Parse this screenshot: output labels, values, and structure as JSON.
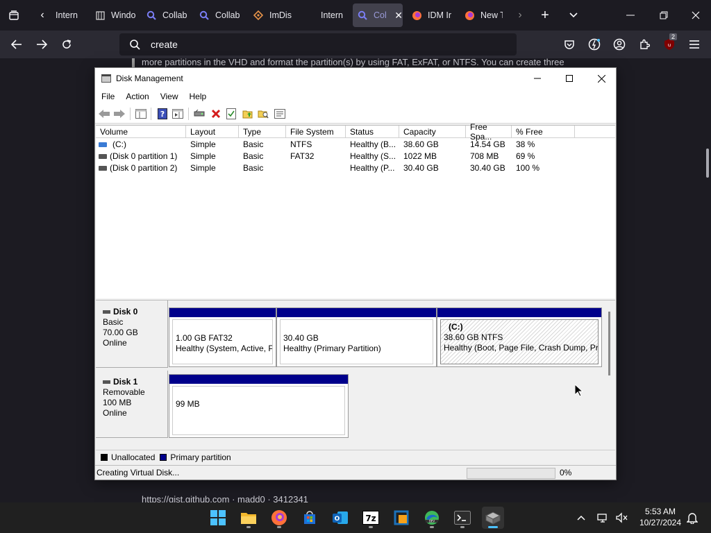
{
  "browser": {
    "tabs": [
      {
        "label": "Intern",
        "icon": "page-icon"
      },
      {
        "label": "Windo",
        "icon": "page-icon"
      },
      {
        "label": "Collab",
        "icon": "search-icon"
      },
      {
        "label": "Collab",
        "icon": "search-icon"
      },
      {
        "label": "ImDis",
        "icon": "code-icon"
      },
      {
        "label": "Intern",
        "icon": "page-icon"
      },
      {
        "label": "Col",
        "icon": "search-icon",
        "active": true
      },
      {
        "label": "IDM Ir",
        "icon": "firefox-icon"
      },
      {
        "label": "New T",
        "icon": "firefox-icon"
      }
    ],
    "url_text": "create",
    "extension_badge": "2"
  },
  "webpage": {
    "text_top": "more partitions in the VHD and format the partition(s) by using FAT, ExFAT, or NTFS. You can create three",
    "text_bottom": "https://gist.github.com · madd0 · 3412341"
  },
  "disk_management": {
    "title": "Disk Management",
    "menu": [
      "File",
      "Action",
      "View",
      "Help"
    ],
    "columns": [
      "Volume",
      "Layout",
      "Type",
      "File System",
      "Status",
      "Capacity",
      "Free Spa...",
      "% Free"
    ],
    "volumes": [
      {
        "volume": "(C:)",
        "layout": "Simple",
        "type": "Basic",
        "fs": "NTFS",
        "status": "Healthy (B...",
        "capacity": "38.60 GB",
        "free": "14.54 GB",
        "pct_free": "38 %"
      },
      {
        "volume": "(Disk 0 partition 1)",
        "layout": "Simple",
        "type": "Basic",
        "fs": "FAT32",
        "status": "Healthy (S...",
        "capacity": "1022 MB",
        "free": "708 MB",
        "pct_free": "69 %"
      },
      {
        "volume": "(Disk 0 partition 2)",
        "layout": "Simple",
        "type": "Basic",
        "fs": "",
        "status": "Healthy (P...",
        "capacity": "30.40 GB",
        "free": "30.40 GB",
        "pct_free": "100 %"
      }
    ],
    "disks": [
      {
        "name": "Disk 0",
        "kind": "Basic",
        "size": "70.00 GB",
        "state": "Online",
        "partitions": [
          {
            "title": "",
            "line1": "1.00 GB FAT32",
            "line2": "Healthy (System, Active, P"
          },
          {
            "title": "",
            "line1": "30.40 GB",
            "line2": "Healthy (Primary Partition)"
          },
          {
            "title": "(C:)",
            "line1": "38.60 GB NTFS",
            "line2": "Healthy (Boot, Page File, Crash Dump, Prir"
          }
        ]
      },
      {
        "name": "Disk 1",
        "kind": "Removable",
        "size": "100 MB",
        "state": "Online",
        "partitions": [
          {
            "title": "",
            "line1": "99 MB",
            "line2": ""
          }
        ]
      }
    ],
    "legend": [
      {
        "label": "Unallocated",
        "color": "#000000"
      },
      {
        "label": "Primary partition",
        "color": "#00008b"
      }
    ],
    "status_text": "Creating Virtual Disk...",
    "progress_percent": 0,
    "progress_label": "0%"
  },
  "taskbar": {
    "apps": [
      "start",
      "file-explorer",
      "firefox",
      "microsoft-store",
      "outlook",
      "7zip",
      "virtualbox",
      "edge-dev",
      "terminal",
      "disk-management"
    ],
    "time": "5:53 AM",
    "date": "10/27/2024"
  },
  "colors": {
    "partition_bar": "#00008b",
    "browser_bg": "#1c1b22",
    "toolbar_bg": "#2b2a33",
    "active_accent": "#4cc2ff"
  }
}
